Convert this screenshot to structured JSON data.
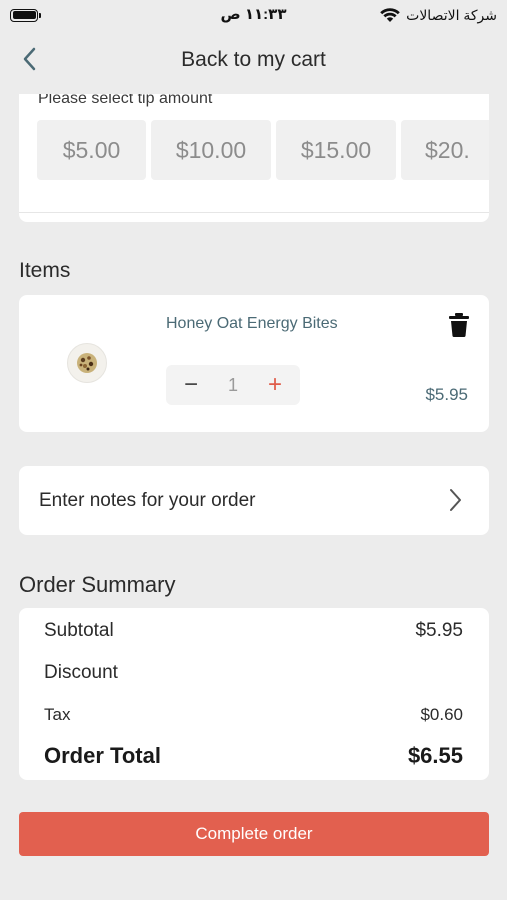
{
  "status_bar": {
    "carrier": "شركة الاتصالات",
    "time": "١١:٣٣ ص"
  },
  "header": {
    "title": "Back to my cart"
  },
  "tip": {
    "label": "Please select tip amount",
    "options": [
      "$5.00",
      "$10.00",
      "$15.00",
      "$20."
    ]
  },
  "items": {
    "section_title": "Items",
    "list": [
      {
        "name": "Honey Oat Energy Bites",
        "quantity": "1",
        "price": "$5.95"
      }
    ],
    "minus_symbol": "−",
    "plus_symbol": "+"
  },
  "notes": {
    "placeholder": "Enter notes for your order"
  },
  "summary": {
    "title": "Order Summary",
    "subtotal_label": "Subtotal",
    "subtotal_value": "$5.95",
    "discount_label": "Discount",
    "tax_label": "Tax",
    "tax_value": "$0.60",
    "total_label": "Order Total",
    "total_value": "$6.55"
  },
  "cta": {
    "label": "Complete order"
  },
  "colors": {
    "accent": "#e2604f",
    "item_text": "#4b6a75",
    "background": "#ececec"
  },
  "icons": [
    "battery-icon",
    "wifi-icon",
    "back-chevron-icon",
    "trash-icon",
    "chevron-right-icon",
    "product-thumbnail"
  ]
}
